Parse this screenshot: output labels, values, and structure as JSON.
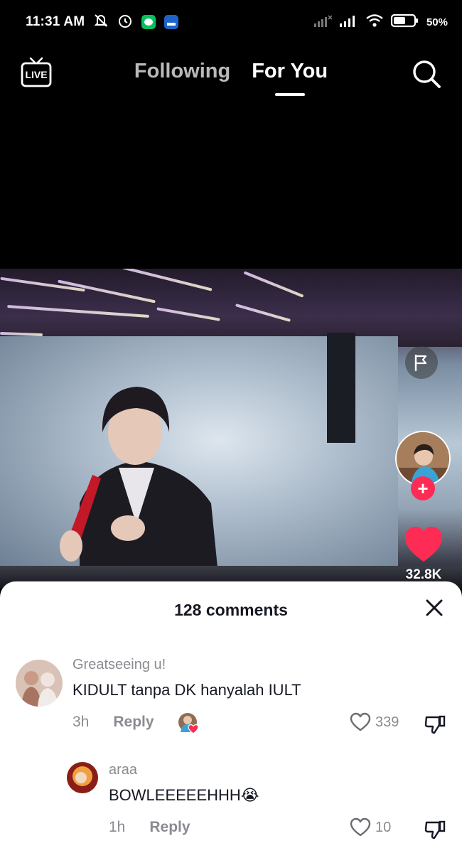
{
  "status_bar": {
    "time": "11:31 AM",
    "battery": "50%",
    "left_icons": [
      "mute-icon",
      "alarm-icon",
      "chat-app-icon",
      "app-icon"
    ],
    "right_icons": [
      "signal-icon",
      "signal-icon",
      "wifi-icon",
      "battery-icon"
    ]
  },
  "top_nav": {
    "live_label": "LIVE",
    "tabs": [
      {
        "label": "Following",
        "active": false
      },
      {
        "label": "For You",
        "active": true
      }
    ]
  },
  "video": {
    "like_count": "32.8K"
  },
  "comments": {
    "title": "128 comments",
    "items": [
      {
        "username": "Greatseeing u!",
        "text": "KIDULT tanpa DK hanyalah IULT",
        "time": "3h",
        "reply_label": "Reply",
        "likes": "339",
        "liked_by_creator": true
      },
      {
        "username": "araa",
        "text": "BOWLEEEEEHHH😭",
        "time": "1h",
        "reply_label": "Reply",
        "likes": "10",
        "is_reply": true
      }
    ]
  },
  "colors": {
    "accent": "#fe2c55",
    "sheet_bg": "#ffffff",
    "muted_text": "#8a8b91"
  }
}
